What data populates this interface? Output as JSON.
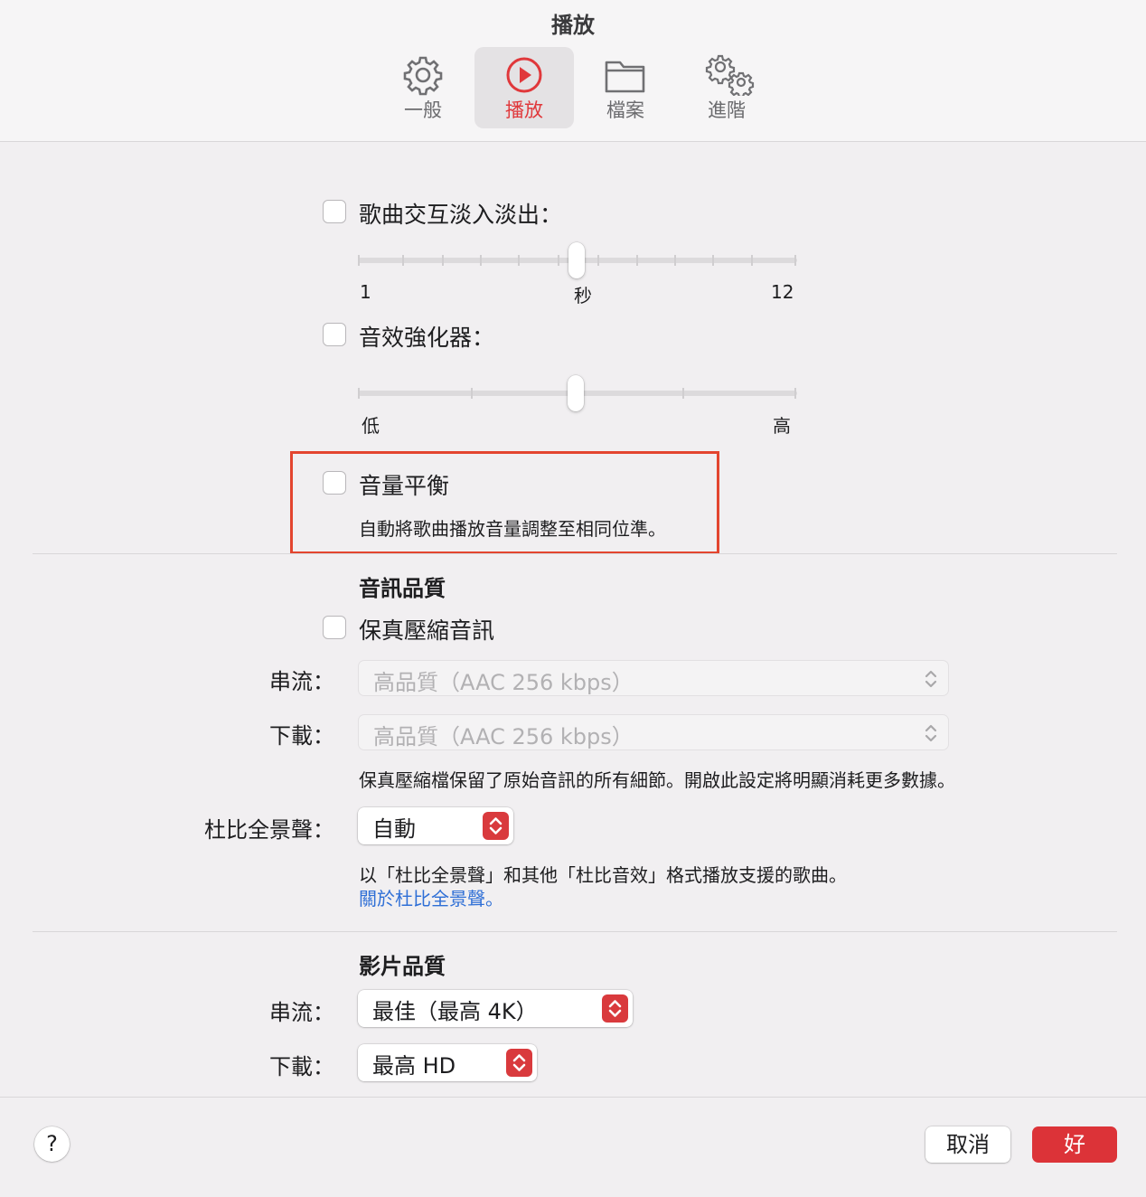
{
  "window": {
    "title": "播放"
  },
  "tabs": [
    {
      "label": "一般",
      "icon": "gear-icon",
      "selected": false
    },
    {
      "label": "播放",
      "icon": "play-circle-icon",
      "selected": true
    },
    {
      "label": "檔案",
      "icon": "folder-icon",
      "selected": false
    },
    {
      "label": "進階",
      "icon": "gears-icon",
      "selected": false
    }
  ],
  "crossfade": {
    "label": "歌曲交互淡入淡出：",
    "checked": false,
    "slider_value": 6,
    "min_label": "1",
    "unit_label": "秒",
    "max_label": "12"
  },
  "enhancer": {
    "label": "音效強化器：",
    "checked": false,
    "slider_value": 0.5,
    "min_label": "低",
    "max_label": "高"
  },
  "sound_check": {
    "label": "音量平衡",
    "checked": false,
    "description": "自動將歌曲播放音量調整至相同位準。"
  },
  "audio_quality": {
    "heading": "音訊品質",
    "lossless_label": "保真壓縮音訊",
    "lossless_checked": false,
    "streaming_label": "串流：",
    "streaming_value": "高品質（AAC 256 kbps）",
    "download_label": "下載：",
    "download_value": "高品質（AAC 256 kbps）",
    "lossless_note": "保真壓縮檔保留了原始音訊的所有細節。開啟此設定將明顯消耗更多數據。",
    "atmos_label": "杜比全景聲：",
    "atmos_value": "自動",
    "atmos_note": "以「杜比全景聲」和其他「杜比音效」格式播放支援的歌曲。",
    "atmos_link": "關於杜比全景聲。"
  },
  "video_quality": {
    "heading": "影片品質",
    "streaming_label": "串流：",
    "streaming_value": "最佳（最高 4K）",
    "download_label": "下載：",
    "download_value": "最高 HD"
  },
  "footer": {
    "help_label": "?",
    "cancel_label": "取消",
    "ok_label": "好"
  },
  "colors": {
    "accent": "#dc3338",
    "highlight_box": "#e3452f",
    "link": "#2f6fd6"
  }
}
